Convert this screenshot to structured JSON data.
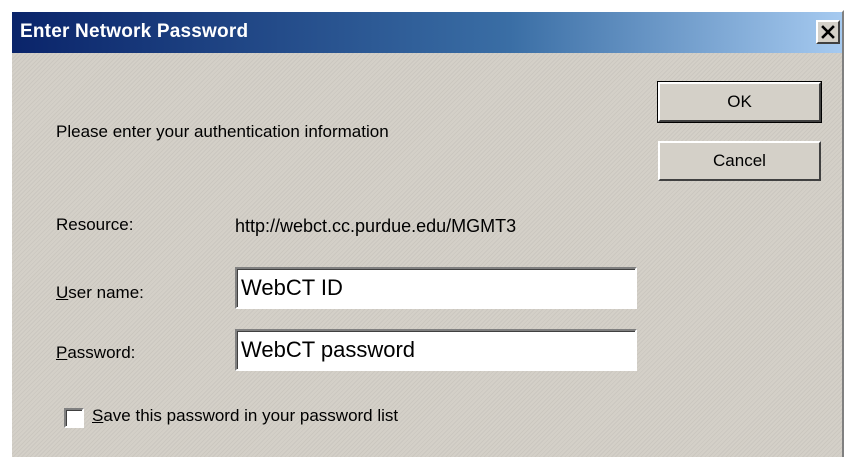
{
  "window": {
    "title": "Enter Network Password",
    "close_icon": "close-icon"
  },
  "prompt": "Please enter your authentication information",
  "buttons": {
    "ok_label": "OK",
    "cancel_label": "Cancel"
  },
  "resource": {
    "label": "Resource:",
    "value": "http://webct.cc.purdue.edu/MGMT3"
  },
  "username": {
    "label": "User name:",
    "value": "WebCT ID"
  },
  "password": {
    "label": "Password:",
    "value": "WebCT password"
  },
  "save_password": {
    "label": "Save this password in your password list",
    "checked": false
  },
  "colors": {
    "titlebar_start": "#0a246a",
    "titlebar_end": "#a6caf0",
    "dialog_face": "#d4d0c8"
  }
}
